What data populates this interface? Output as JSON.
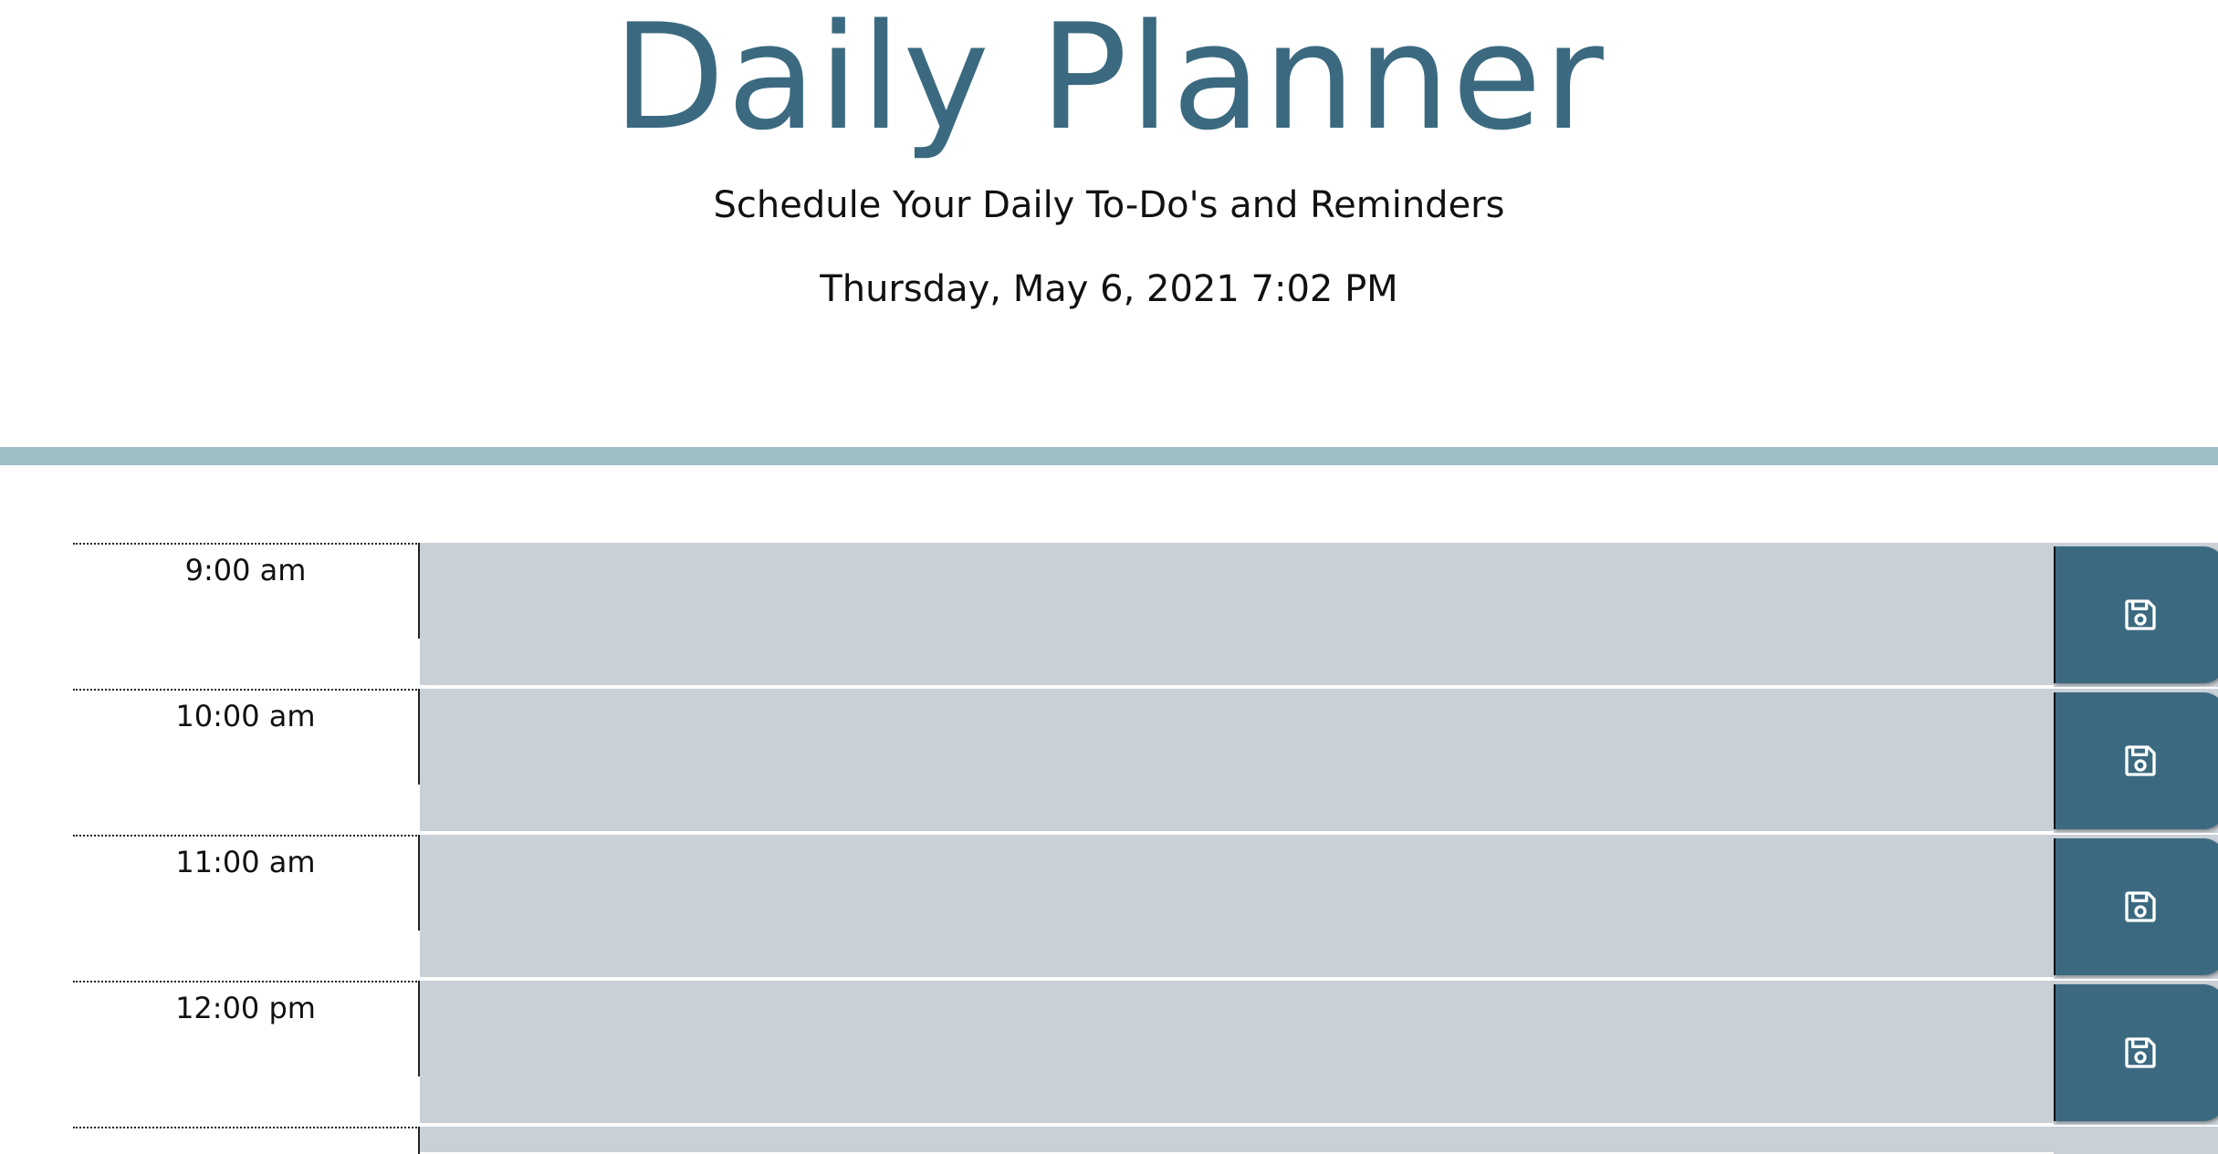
{
  "header": {
    "title": "Daily Planner",
    "subtitle": "Schedule Your Daily To-Do's and Reminders",
    "current_day": "Thursday, May 6, 2021 7:02 PM"
  },
  "colors": {
    "title": "#3b6a80",
    "divider": "#9dbfc6",
    "past_block": "#c9d0d7",
    "save_button": "#3b6a80"
  },
  "time_blocks": [
    {
      "hour": "9:00 am",
      "text": "",
      "save_icon": "floppy-disk-icon"
    },
    {
      "hour": "10:00 am",
      "text": "",
      "save_icon": "floppy-disk-icon"
    },
    {
      "hour": "11:00 am",
      "text": "",
      "save_icon": "floppy-disk-icon"
    },
    {
      "hour": "12:00 pm",
      "text": "",
      "save_icon": "floppy-disk-icon"
    }
  ]
}
